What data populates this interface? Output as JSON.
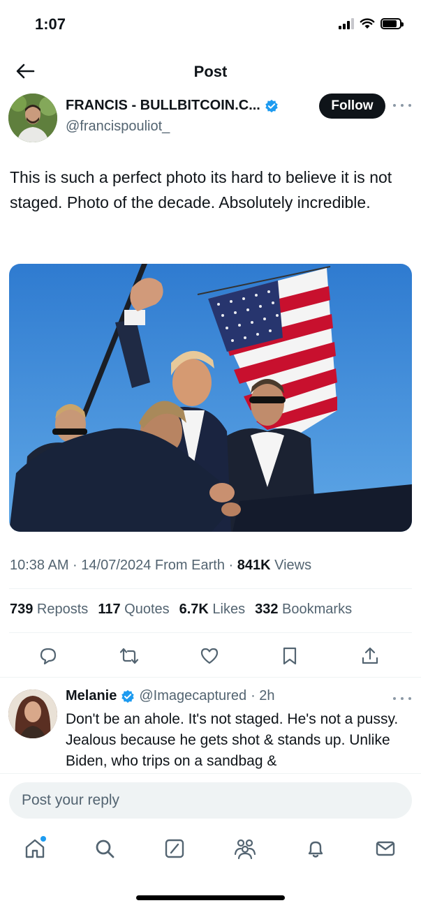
{
  "status_bar": {
    "time": "1:07",
    "battery_level": 0.85
  },
  "header": {
    "title": "Post",
    "back_icon": "arrow-left-icon"
  },
  "author": {
    "name": "FRANCIS - BULLBITCOIN.C...",
    "handle": "@francispouliot_",
    "verified": true,
    "follow_label": "Follow"
  },
  "tweet": {
    "text": "This is such a perfect photo its hard to believe it is not staged. Photo of the decade. Absolutely incredible."
  },
  "meta": {
    "timestamp": "10:38 AM · 14/07/2024 From Earth · ",
    "views_count": "841K",
    "views_label": " Views"
  },
  "stats": {
    "reposts_count": "739",
    "reposts_label": " Reposts",
    "quotes_count": "117",
    "quotes_label": " Quotes",
    "likes_count": "6.7K",
    "likes_label": " Likes",
    "bookmarks_count": "332",
    "bookmarks_label": " Bookmarks"
  },
  "actions": [
    "reply-icon",
    "repost-icon",
    "like-icon",
    "bookmark-icon",
    "share-icon"
  ],
  "reply": {
    "name": "Melanie",
    "verified": true,
    "handle": "@Imagecaptured",
    "time": "· 2h",
    "text": "Don't be an ahole. It's not staged. He's not a pussy. Jealous because he gets shot & stands up.  Unlike Biden, who trips on a sandbag &"
  },
  "reply_box": {
    "placeholder": "Post your reply"
  },
  "bottom_nav": [
    "home-icon",
    "search-icon",
    "grok-icon",
    "communities-icon",
    "notifications-icon",
    "messages-icon"
  ],
  "colors": {
    "accent": "#1d9bf0",
    "text": "#0f1419",
    "secondary": "#536471",
    "divider": "#eff3f4"
  }
}
